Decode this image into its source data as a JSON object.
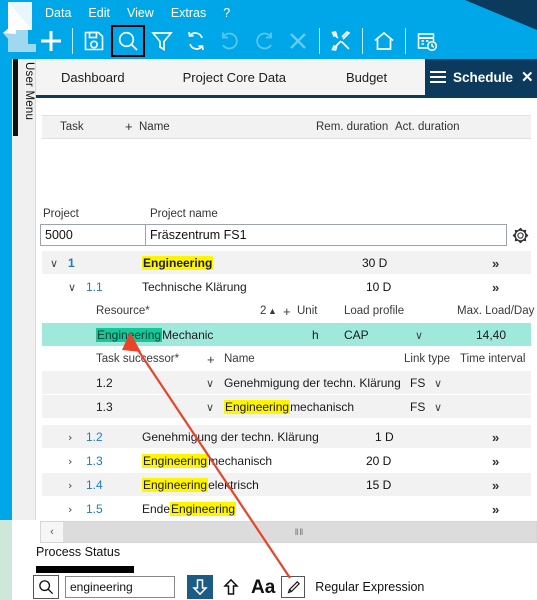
{
  "app": {
    "logo_icon": "document-arrow-logo"
  },
  "menubar": {
    "items": [
      {
        "label": "Data"
      },
      {
        "label": "Edit"
      },
      {
        "label": "View"
      },
      {
        "label": "Extras"
      },
      {
        "label": "?"
      }
    ]
  },
  "toolbar": {
    "items": [
      {
        "name": "new-icon",
        "title": "New"
      },
      {
        "name": "save-icon",
        "title": "Save"
      },
      {
        "name": "search-icon",
        "title": "Search",
        "active": true
      },
      {
        "name": "filter-icon",
        "title": "Filter"
      },
      {
        "name": "refresh-icon",
        "title": "Refresh"
      },
      {
        "name": "undo-icon",
        "title": "Undo"
      },
      {
        "name": "redo-icon",
        "title": "Redo"
      },
      {
        "name": "delete-icon",
        "title": "Delete"
      },
      {
        "name": "tools-icon",
        "title": "Tools"
      },
      {
        "name": "home-icon",
        "title": "Home"
      },
      {
        "name": "schedule-calendar-icon",
        "title": "Schedule"
      }
    ]
  },
  "sidebar": {
    "user_menu_label": "User Menu"
  },
  "tabs": {
    "items": [
      {
        "label": "Dashboard"
      },
      {
        "label": "Project Core Data"
      },
      {
        "label": "Budget"
      }
    ],
    "active": {
      "label": "Schedule",
      "close_label": "✕",
      "menu_icon": "hamburger-icon"
    }
  },
  "grid": {
    "headers": {
      "task": "Task",
      "plus": "+",
      "name": "Name",
      "rem_duration": "Rem. duration",
      "act_duration": "Act. duration"
    }
  },
  "project": {
    "id_label": "Project",
    "name_label": "Project name",
    "id_value": "5000",
    "name_value": "Fräszentrum FS1",
    "settings_icon": "gear-icon"
  },
  "tasks": [
    {
      "type": "task",
      "expander": "∨",
      "wbs": "1",
      "bold": true,
      "name_pre": "",
      "name_hl": "Engineering",
      "name_post": "",
      "duration": "30 D",
      "more": "»"
    },
    {
      "type": "task",
      "expander": "∨",
      "wbs": "1.1",
      "bold": false,
      "name_pre": "Technische Klärung",
      "name_hl": "",
      "name_post": "",
      "duration": "10 D",
      "more": "»"
    }
  ],
  "resource_block": {
    "headers": {
      "resource": "Resource*",
      "count": "2",
      "count_arrow": "▲",
      "plus": "+",
      "unit": "Unit",
      "load_profile": "Load profile",
      "max_load": "Max. Load/Day"
    },
    "row": {
      "resource_selected": "Engineering",
      "resource_rest": "Mechanic",
      "unit": "h",
      "load_profile": "CAP",
      "load_profile_chevron": "∨",
      "max_load": "14,40"
    }
  },
  "successor_block": {
    "headers": {
      "task_successor": "Task successor*",
      "plus": "+",
      "name": "Name",
      "link_type": "Link type",
      "time_interval": "Time interval"
    },
    "rows": [
      {
        "wbs": "1.2",
        "chevron": "∨",
        "name_pre": "Genehmigung der techn. Klärung",
        "name_hl": "",
        "name_post": "",
        "link_type": "FS",
        "link_chevron": "∨",
        "time_interval": ""
      },
      {
        "wbs": "1.3",
        "chevron": "∨",
        "name_pre": "",
        "name_hl": "Engineering",
        "name_post": " mechanisch",
        "link_type": "FS",
        "link_chevron": "∨",
        "time_interval": ""
      }
    ]
  },
  "tasks_bottom": [
    {
      "expander": "›",
      "wbs": "1.2",
      "name_pre": "Genehmigung der techn. Klärung",
      "name_hl": "",
      "name_post": "",
      "duration": "1 D",
      "more": "»"
    },
    {
      "expander": "›",
      "wbs": "1.3",
      "name_pre": "",
      "name_hl": "Engineering",
      "name_post": " mechanisch",
      "duration": "20 D",
      "more": "»"
    },
    {
      "expander": "›",
      "wbs": "1.4",
      "name_pre": "",
      "name_hl": "Engineering",
      "name_post": " elektrisch",
      "duration": "15 D",
      "more": "»"
    },
    {
      "expander": "›",
      "wbs": "1.5",
      "name_pre": "Ende ",
      "name_hl": "Engineering",
      "name_post": "",
      "duration": "",
      "more": "»"
    }
  ],
  "scrollbar": {
    "left_arrow": "‹",
    "grip": "‖‖"
  },
  "process_status": {
    "label": "Process Status"
  },
  "find_bar": {
    "search_icon": "magnifier-icon",
    "query": "engineering",
    "placeholder": "",
    "find_next_icon": "arrow-down-icon",
    "find_prev_icon": "arrow-up-icon",
    "match_case_label": "Aa",
    "highlight_icon": "highlighter-pen-icon",
    "regex_label": "Regular Expression"
  },
  "colors": {
    "ribbon_blue": "#00A7E8",
    "navy": "#0B3A5C",
    "highlight_yellow": "#FFF500",
    "selection_teal": "#9EE8DC",
    "selection_green": "#16C79A",
    "wbs_blue": "#1E7BC4",
    "annotation_red": "#E8442A"
  }
}
